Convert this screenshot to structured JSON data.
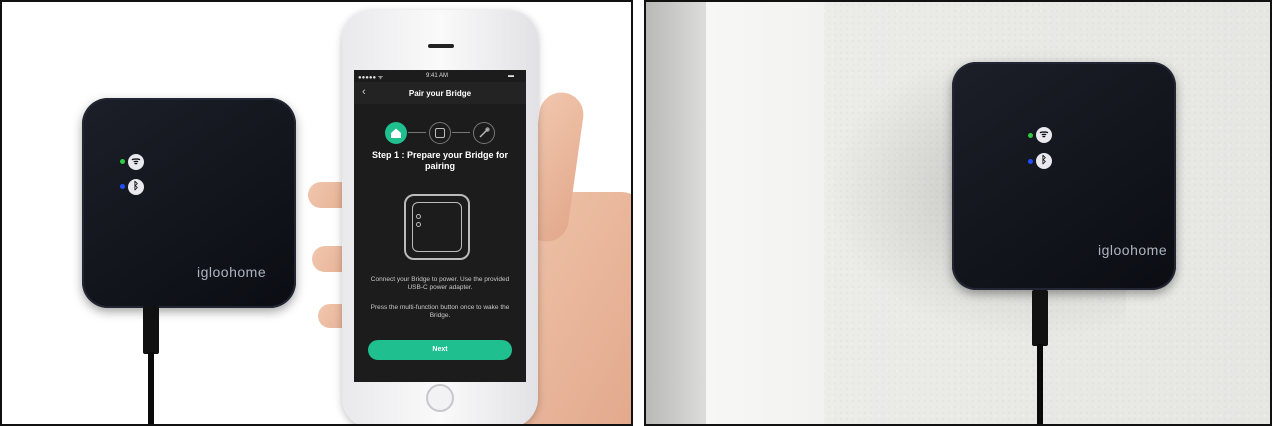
{
  "left_photo": {
    "device": {
      "brand": "igloohome",
      "icons": [
        "wifi-icon",
        "bluetooth-icon"
      ],
      "led_colors": [
        "#2ecc40",
        "#1e4fff"
      ]
    },
    "phone": {
      "status": {
        "carrier": "●●●●● ᯤ",
        "time": "9:41 AM",
        "battery": "▬"
      },
      "nav_title": "Pair your Bridge",
      "back_glyph": "‹",
      "heading": "Step 1 : Prepare your Bridge for pairing",
      "body1": "Connect your Bridge to power. Use the provided USB-C power adapter.",
      "body2": "Press the multi-function button once to wake the Bridge.",
      "button": "Next",
      "accent": "#1fbf8f"
    }
  },
  "right_photo": {
    "device": {
      "brand": "igloohome",
      "icons": [
        "wifi-icon",
        "bluetooth-icon"
      ],
      "led_colors": [
        "#2ecc40",
        "#1e4fff"
      ]
    }
  }
}
